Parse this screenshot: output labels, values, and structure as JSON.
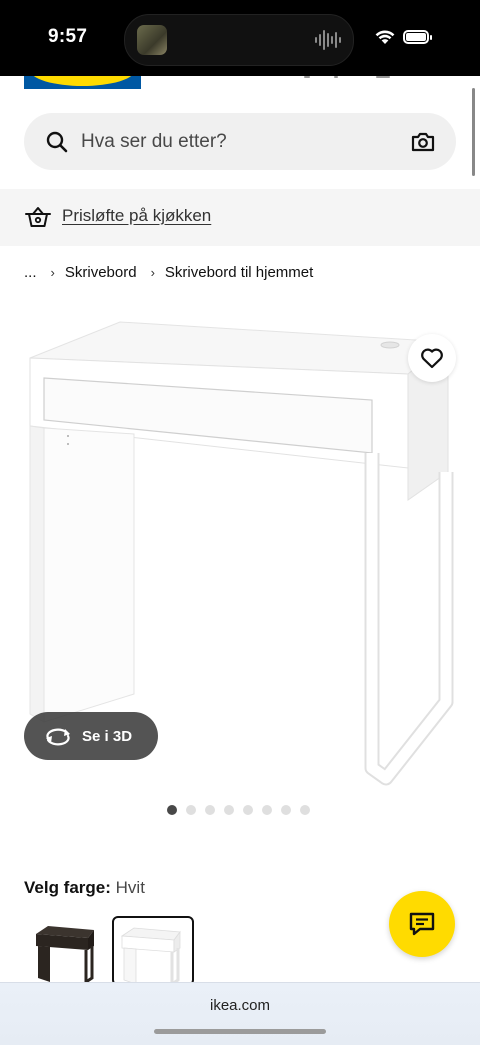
{
  "status_bar": {
    "time": "9:57"
  },
  "search": {
    "placeholder": "Hva ser du etter?"
  },
  "promo": {
    "link_text": "Prisløfte på kjøkken"
  },
  "breadcrumb": {
    "items": [
      "...",
      "Skrivebord",
      "Skrivebord til hjemmet"
    ]
  },
  "product": {
    "view_3d_label": "Se i 3D",
    "carousel": {
      "total": 8,
      "active_index": 0
    }
  },
  "color": {
    "label": "Velg farge:",
    "value": "Hvit",
    "options": [
      {
        "name": "black",
        "color": "#2b2520",
        "selected": false
      },
      {
        "name": "white",
        "color": "#ffffff",
        "selected": true
      }
    ]
  },
  "browser": {
    "url": "ikea.com"
  },
  "theme": {
    "brand_yellow": "#ffdb00",
    "brand_blue": "#0058a3"
  }
}
